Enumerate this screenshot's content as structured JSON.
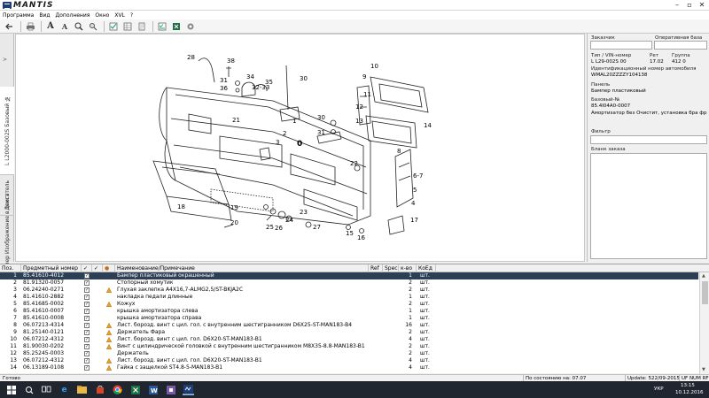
{
  "app": {
    "logo_text": "MANTIS",
    "window_controls": [
      "–",
      "▫",
      "✕"
    ]
  },
  "menu": [
    "Программа",
    "Вид",
    "Дополнения",
    "Окно",
    "XVL",
    "?"
  ],
  "toolbar_icons": [
    "back-arrow-icon",
    "printer-icon",
    "text-A-large-icon",
    "text-A-small-icon",
    "zoom-icon",
    "search-icon",
    "checklist-icon",
    "grid-icon",
    "sheet-icon",
    "checklist-alt-icon",
    "excel-icon",
    "palette-icon"
  ],
  "left_tabs": {
    "arrow": ">",
    "catalog": "L L2000-002S",
    "base_number": "Базовый №",
    "engine": "Двигатель",
    "vin": "VIN-номер",
    "text_image": "Изображение в текст"
  },
  "diagram": {
    "callouts": [
      "28",
      "38",
      "34",
      "35",
      "31",
      "36",
      "32-33",
      "30",
      "10",
      "9",
      "11",
      "21",
      "2",
      "3",
      "31",
      "30",
      "12",
      "13",
      "14",
      "1",
      "22",
      "6-7",
      "5",
      "4",
      "8",
      "18",
      "19",
      "20",
      "17",
      "15",
      "24",
      "25",
      "26",
      "23",
      "27",
      "16"
    ],
    "center_label": "0"
  },
  "right_panel": {
    "customer_label": "Заказчик",
    "operational_label": "Оперативная база",
    "type_vin_label": "Тип / VIN-номер",
    "type_vin_value": "L L29-002S 00",
    "ret_label": "Рет",
    "ret_value": "17.02",
    "group_label": "Группа",
    "group_value": "412 0",
    "vehicle_id_label": "Идентификационный номер автомобиля",
    "vehicle_id_value": "WMAL20ZZZZY104138",
    "panel_label": "Панель",
    "panel_value": "Бампер пластиковый",
    "base_number_label": "Базовый-№",
    "base_number_value": "85.4I04A0-0007",
    "shock_text": "Амортизатор без Очистит, установка бра фр",
    "filter_label": "Фильтр",
    "order_form_label": "Бланк заказа"
  },
  "table": {
    "headers": {
      "pos": "Поз.",
      "part": "Предметный номер",
      "c1": "✓",
      "c2": "✓",
      "c3": "●",
      "name": "Наименование/Примечание",
      "ref": "Ref",
      "spec": "Spec",
      "qty": "к-во",
      "unit": "КоЕд"
    },
    "rows": [
      {
        "pos": "1",
        "part": "85.41610-4012",
        "c1": "✓",
        "warn": false,
        "name": "Бампер пластиковый окрашенный",
        "qty": "1",
        "unit": "шт."
      },
      {
        "pos": "2",
        "part": "81.91320-0057",
        "c1": "✓",
        "warn": false,
        "name": "Стопорный хомутик",
        "qty": "2",
        "unit": "шт."
      },
      {
        "pos": "3",
        "part": "06.24240-0271",
        "c1": "✓",
        "warn": true,
        "name": "Глухая заклепка А4Х16,7-ALMG2,5/ST-BKJA2C",
        "qty": "2",
        "unit": "шт."
      },
      {
        "pos": "4",
        "part": "81.41610-2882",
        "c1": "✓",
        "warn": false,
        "name": "накладка педали длинные",
        "qty": "1",
        "unit": "шт."
      },
      {
        "pos": "5",
        "part": "85.41685-0002",
        "c1": "✓",
        "warn": true,
        "name": "Кожух",
        "qty": "2",
        "unit": "шт."
      },
      {
        "pos": "6",
        "part": "85.41610-0007",
        "c1": "✓",
        "warn": false,
        "name": "крышка амортизатора слева",
        "qty": "1",
        "unit": "шт."
      },
      {
        "pos": "7",
        "part": "85.41610-0008",
        "c1": "✓",
        "warn": false,
        "name": "крышка амортизатора справа",
        "qty": "1",
        "unit": "шт."
      },
      {
        "pos": "8",
        "part": "06.07213-4314",
        "c1": "✓",
        "warn": true,
        "name": "Лист. борозд. винт с цил. гол. с внутренним шестигранником D6X25-ST-MAN183-B4",
        "qty": "16",
        "unit": "шт."
      },
      {
        "pos": "9",
        "part": "81.25140-0121",
        "c1": "✓",
        "warn": true,
        "name": "Держатель Фара",
        "qty": "2",
        "unit": "шт."
      },
      {
        "pos": "10",
        "part": "06.07212-4312",
        "c1": "✓",
        "warn": true,
        "name": "Лист. борозд. винт с цил. гол. D6X20-ST-MAN183-B1",
        "qty": "4",
        "unit": "шт."
      },
      {
        "pos": "11",
        "part": "81.90030-0202",
        "c1": "✓",
        "warn": true,
        "name": "Винт с цилиндрической головкой с внутренним шестигранником M8X35-8.8-MAN183-B1",
        "qty": "2",
        "unit": "шт."
      },
      {
        "pos": "12",
        "part": "85.25245-0003",
        "c1": "✓",
        "warn": false,
        "name": "Держатель",
        "qty": "2",
        "unit": "шт."
      },
      {
        "pos": "13",
        "part": "06.07212-4312",
        "c1": "✓",
        "warn": true,
        "name": "Лист. борозд. винт с цил. гол. D6X20-ST-MAN183-B1",
        "qty": "4",
        "unit": "шт."
      },
      {
        "pos": "14",
        "part": "06.13189-0108",
        "c1": "✓",
        "warn": true,
        "name": "Гайка с защелкой ST4.8-5-MAN183-B1",
        "qty": "4",
        "unit": "шт."
      }
    ]
  },
  "status": {
    "ready": "Готово",
    "last_changed": "По состоянию на: 07.07",
    "update": "Update: 522/09-2015",
    "indicators": "UF  NUM  RF"
  },
  "taskbar": {
    "icons": [
      "windows-start-icon",
      "search-icon",
      "task-view-icon",
      "edge-icon",
      "file-explorer-icon",
      "store-icon",
      "chrome-icon",
      "excel-icon",
      "word-icon",
      "app-icon",
      "mantis-icon"
    ],
    "language": "УКР",
    "time": "13:15",
    "date": "10.12.2016"
  }
}
